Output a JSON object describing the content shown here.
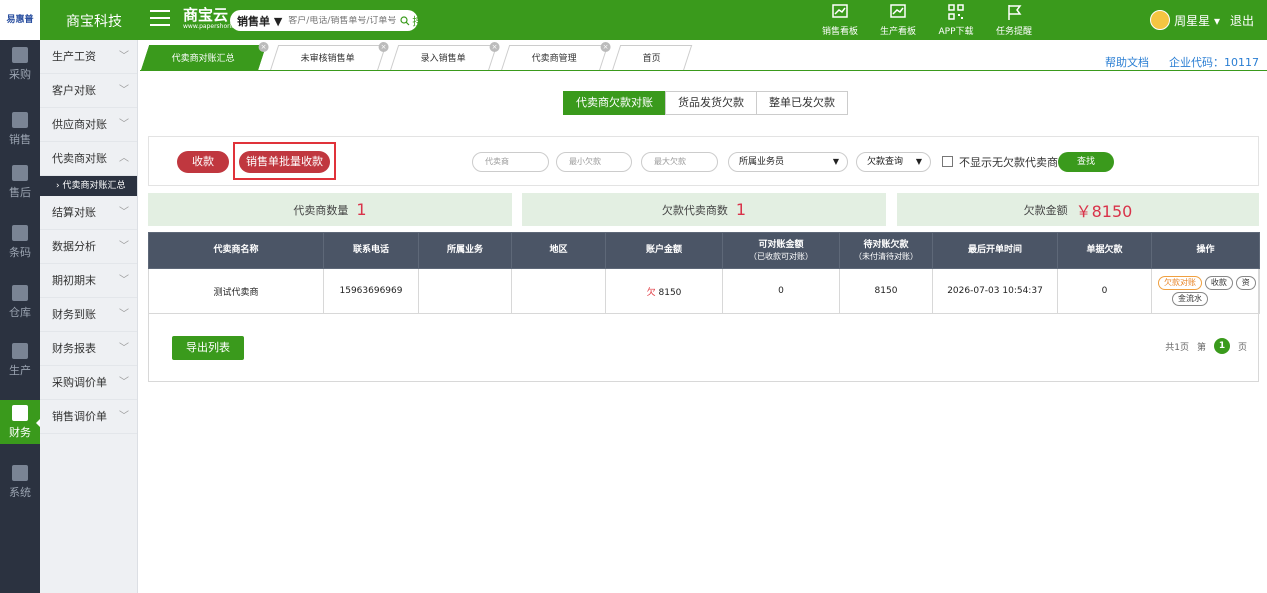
{
  "topbar": {
    "logo_text": "易惠普",
    "company": "商宝科技",
    "brand_main": "商宝云",
    "brand_sub": "www.papershoring.cn",
    "search_select": "销售单 ▼",
    "search_placeholder": "客户/电话/销售单号/订单号",
    "search_button": "搜索",
    "icons": [
      {
        "label": "销售看板",
        "icon": "sales-board-icon"
      },
      {
        "label": "生产看板",
        "icon": "production-board-icon"
      },
      {
        "label": "APP下载",
        "icon": "qr-code-icon"
      },
      {
        "label": "任务提醒",
        "icon": "flag-icon"
      }
    ],
    "user_name": "周星星 ▾",
    "logout": "退出"
  },
  "iconbar": [
    {
      "label": "采购",
      "icon": "cart-icon"
    },
    {
      "label": "销售",
      "icon": "sales-icon"
    },
    {
      "label": "售后",
      "icon": "after-sales-icon"
    },
    {
      "label": "条码",
      "icon": "barcode-icon"
    },
    {
      "label": "仓库",
      "icon": "warehouse-icon"
    },
    {
      "label": "生产",
      "icon": "production-icon"
    },
    {
      "label": "财务",
      "icon": "calculator-icon",
      "active": true
    },
    {
      "label": "系统",
      "icon": "gear-icon"
    }
  ],
  "sidemenu": {
    "items": [
      "生产工资",
      "客户对账",
      "供应商对账",
      "代卖商对账",
      "结算对账",
      "数据分析",
      "期初期末",
      "财务到账",
      "财务报表",
      "采购调价单",
      "销售调价单"
    ],
    "active_sub": "› 代卖商对账汇总"
  },
  "tabs": [
    {
      "label": "代卖商对账汇总",
      "active": true
    },
    {
      "label": "未审核销售单"
    },
    {
      "label": "录入销售单"
    },
    {
      "label": "代卖商管理"
    },
    {
      "label": "首页"
    }
  ],
  "toplinks": {
    "help": "帮助文档",
    "corp": "企业代码：10117"
  },
  "segments": [
    "代卖商欠款对账",
    "货品发货欠款",
    "整单已发欠款"
  ],
  "filters": {
    "collect_btn": "收款",
    "batch_btn": "销售单批量收款",
    "agent_placeholder": "代卖商",
    "min_debt_placeholder": "最小欠款",
    "max_debt_placeholder": "最大欠款",
    "salesman_select": "所属业务员",
    "debt_query_select": "欠款查询",
    "hide_no_debt_label": "不显示无欠款代卖商",
    "search_btn": "查找"
  },
  "summary": {
    "agent_count_label": "代卖商数量",
    "agent_count": "1",
    "debt_agent_label": "欠款代卖商数",
    "debt_agent": "1",
    "debt_amount_label": "欠款金额",
    "debt_amount": "￥8150"
  },
  "table": {
    "headers": [
      {
        "main": "代卖商名称",
        "sub": ""
      },
      {
        "main": "联系电话",
        "sub": ""
      },
      {
        "main": "所属业务",
        "sub": ""
      },
      {
        "main": "地区",
        "sub": ""
      },
      {
        "main": "账户金额",
        "sub": ""
      },
      {
        "main": "可对账金额",
        "sub": "（已收款可对账）"
      },
      {
        "main": "待对账欠款",
        "sub": "（未付清待对账）"
      },
      {
        "main": "最后开单时间",
        "sub": ""
      },
      {
        "main": "单据欠款",
        "sub": ""
      },
      {
        "main": "操作",
        "sub": ""
      }
    ],
    "row": {
      "name": "测试代卖商",
      "phone": "15963696969",
      "business": "",
      "region": "",
      "account_prefix": "欠",
      "account_amount": " 8150",
      "reconcilable": "0",
      "pending": "8150",
      "last_time": "2026-07-03 10:54:37",
      "doc_debt": "0",
      "ops": [
        "欠款对账",
        "收款",
        "资",
        "金流水"
      ]
    }
  },
  "export_btn": "导出列表",
  "pager": {
    "total": "共1页",
    "di": "第",
    "page": "1",
    "ye": "页"
  }
}
